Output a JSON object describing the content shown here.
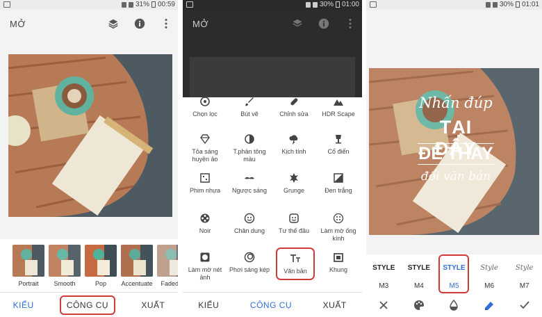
{
  "panel1": {
    "status": {
      "battery": "31%",
      "time": "00:59"
    },
    "title": "MỞ",
    "presets": [
      {
        "label": "Portrait"
      },
      {
        "label": "Smooth"
      },
      {
        "label": "Pop"
      },
      {
        "label": "Accentuate"
      },
      {
        "label": "Faded G"
      }
    ],
    "tabs": {
      "styles": "KIỂU",
      "tools": "CÔNG CỤ",
      "export": "XUẤT"
    }
  },
  "panel2": {
    "status": {
      "battery": "30%",
      "time": "01:00"
    },
    "title": "MỞ",
    "tools": [
      {
        "label": "Chọn lọc",
        "icon": "target-icon"
      },
      {
        "label": "Bút vẽ",
        "icon": "brush-icon"
      },
      {
        "label": "Chỉnh sửa",
        "icon": "bandage-icon"
      },
      {
        "label": "HDR Scape",
        "icon": "mountain-icon"
      },
      {
        "label": "Tỏa sáng huyền ảo",
        "icon": "diamond-icon"
      },
      {
        "label": "T.phản tông màu",
        "icon": "contrast-icon"
      },
      {
        "label": "Kịch tính",
        "icon": "cloud-icon"
      },
      {
        "label": "Cổ điển",
        "icon": "lamp-icon"
      },
      {
        "label": "Phim nhựa",
        "icon": "film-icon"
      },
      {
        "label": "Ngược sáng",
        "icon": "mustache-icon"
      },
      {
        "label": "Grunge",
        "icon": "grunge-icon"
      },
      {
        "label": "Đen trắng",
        "icon": "bw-icon"
      },
      {
        "label": "Noir",
        "icon": "reel-icon"
      },
      {
        "label": "Chân dung",
        "icon": "face-icon"
      },
      {
        "label": "Tư thế đầu",
        "icon": "smile-icon"
      },
      {
        "label": "Làm mờ ống kính",
        "icon": "lens-blur-icon"
      },
      {
        "label": "Làm mờ nét ảnh",
        "icon": "vignette-icon"
      },
      {
        "label": "Phơi sáng kép",
        "icon": "double-exposure-icon"
      },
      {
        "label": "Văn bản",
        "icon": "text-icon"
      },
      {
        "label": "Khung",
        "icon": "frame-icon"
      }
    ],
    "tabs": {
      "styles": "KIỂU",
      "tools": "CÔNG CỤ",
      "export": "XUẤT"
    }
  },
  "panel3": {
    "status": {
      "battery": "30%",
      "time": "01:01"
    },
    "overlay": {
      "line1": "Nhấn đúp",
      "line2": "TẠI ĐÂY",
      "line3": "ĐỂ THAY",
      "line4": "đổi văn bản"
    },
    "styles": [
      {
        "name": "M3",
        "preview": "STYLE"
      },
      {
        "name": "M4",
        "preview": "STYLE"
      },
      {
        "name": "M5",
        "preview": "STYLE"
      },
      {
        "name": "M6",
        "preview": "Style"
      },
      {
        "name": "M7",
        "preview": "Style"
      }
    ],
    "bottom_icons": [
      "close-icon",
      "palette-icon",
      "opacity-icon",
      "style-icon",
      "check-icon"
    ]
  },
  "colors": {
    "accent": "#2f6fd8",
    "highlight_box": "#d23a3a",
    "dim": "#2c2c2c"
  }
}
